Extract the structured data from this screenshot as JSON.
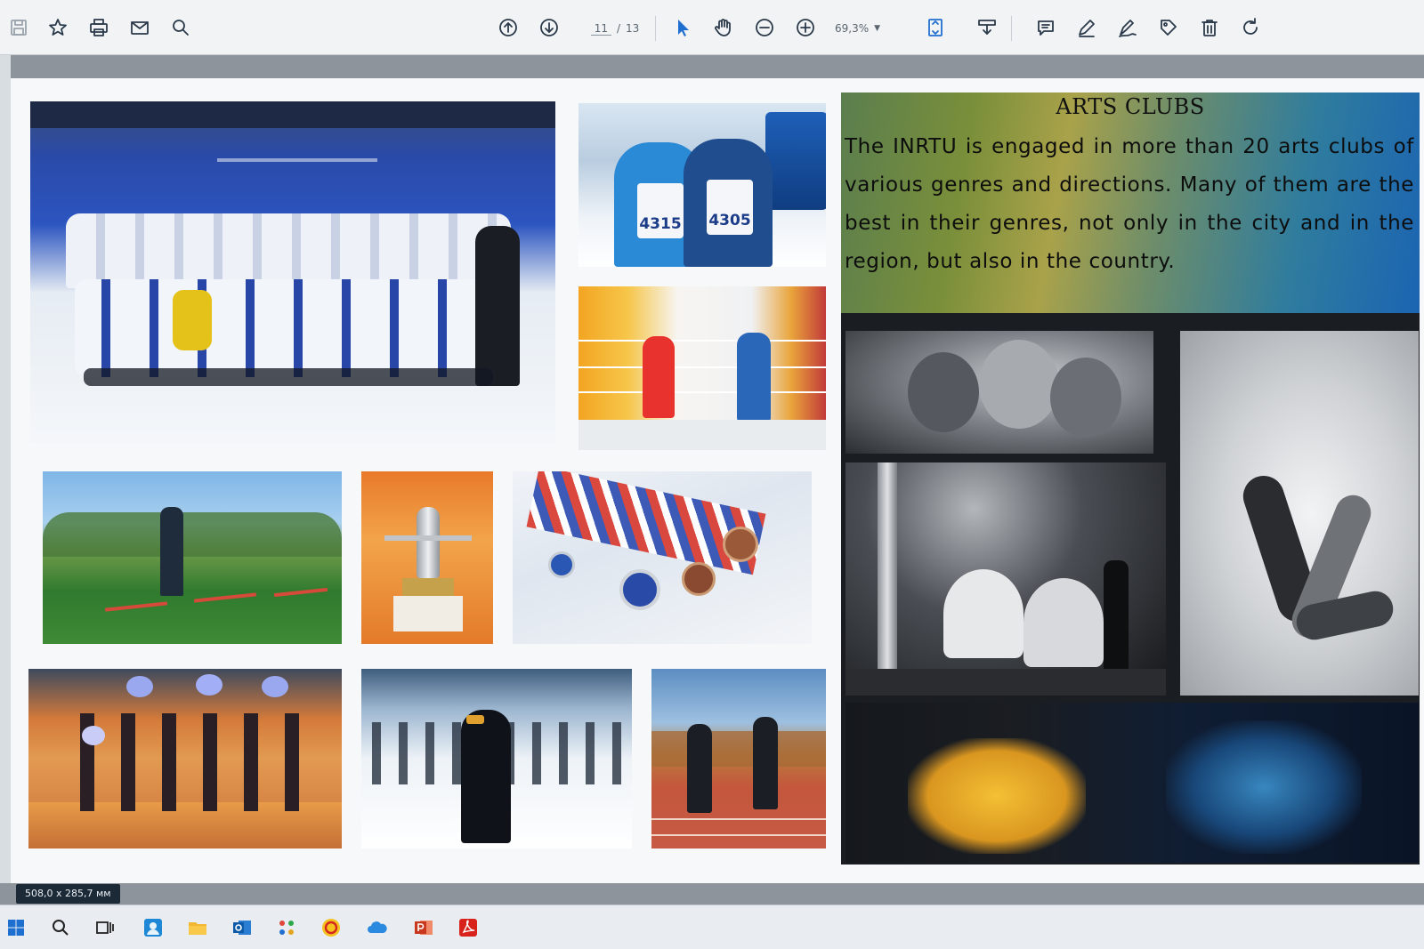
{
  "toolbar": {
    "page_current": "11",
    "page_separator": "/",
    "page_total": "13",
    "zoom": "69,3%"
  },
  "status": {
    "dimensions": "508,0 x 285,7 мм"
  },
  "arts": {
    "title": "ARTS CLUBS",
    "text": "The INRTU is engaged in more than 20 arts clubs of various genres and directions. Many of them are the best in their genres, not only in the city and in the region, but also in the country."
  },
  "photos": {
    "runners_bibs": [
      "4315",
      "4305"
    ]
  },
  "colors": {
    "toolbar_bg": "#f1f3f5",
    "accent_blue": "#1f6fd0",
    "arts_gradient_start": "#5a7e4e",
    "arts_gradient_end": "#1b64b2"
  },
  "icons": {
    "toolbar": [
      "save-icon",
      "star-icon",
      "print-icon",
      "mail-icon",
      "search-icon",
      "arrow-up-icon",
      "arrow-down-icon",
      "pointer-icon",
      "hand-icon",
      "zoom-out-icon",
      "zoom-in-icon",
      "fit-page-icon",
      "download-icon",
      "comment-icon",
      "pen-icon",
      "sign-icon",
      "stamp-icon",
      "trash-icon",
      "rotate-icon"
    ],
    "taskbar": [
      "windows-icon",
      "search-icon",
      "task-view-icon",
      "people-icon",
      "folder-icon",
      "outlook-icon",
      "apps-icon",
      "1c-icon",
      "cloud-icon",
      "powerpoint-icon",
      "acrobat-icon"
    ]
  }
}
